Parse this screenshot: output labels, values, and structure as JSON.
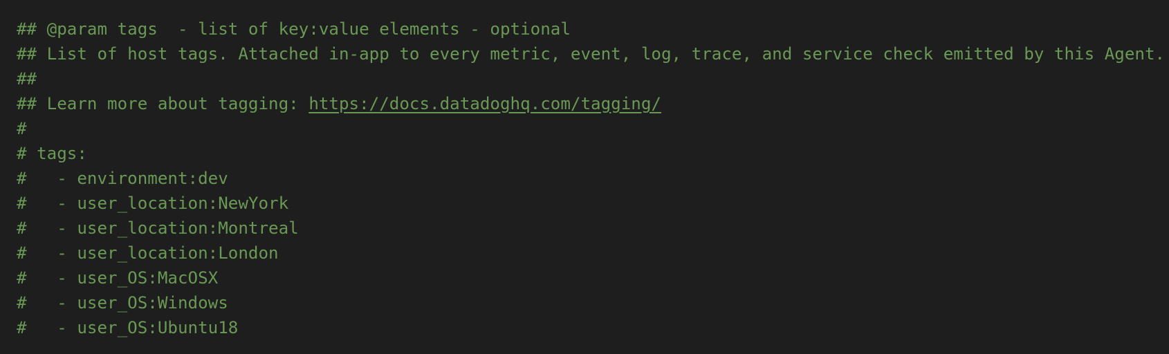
{
  "code": {
    "lines": [
      "## @param tags  - list of key:value elements - optional",
      "## List of host tags. Attached in-app to every metric, event, log, trace, and service check emitted by this Agent.",
      "##",
      "",
      "#",
      "# tags:",
      "#   - environment:dev",
      "#   - user_location:NewYork",
      "#   - user_location:Montreal",
      "#   - user_location:London",
      "#   - user_OS:MacOSX",
      "#   - user_OS:Windows",
      "#   - user_OS:Ubuntu18"
    ],
    "learn_more_prefix": "## Learn more about tagging: ",
    "learn_more_url": "https://docs.datadoghq.com/tagging/"
  },
  "colors": {
    "background": "#1e1e1e",
    "comment": "#6a9955"
  }
}
